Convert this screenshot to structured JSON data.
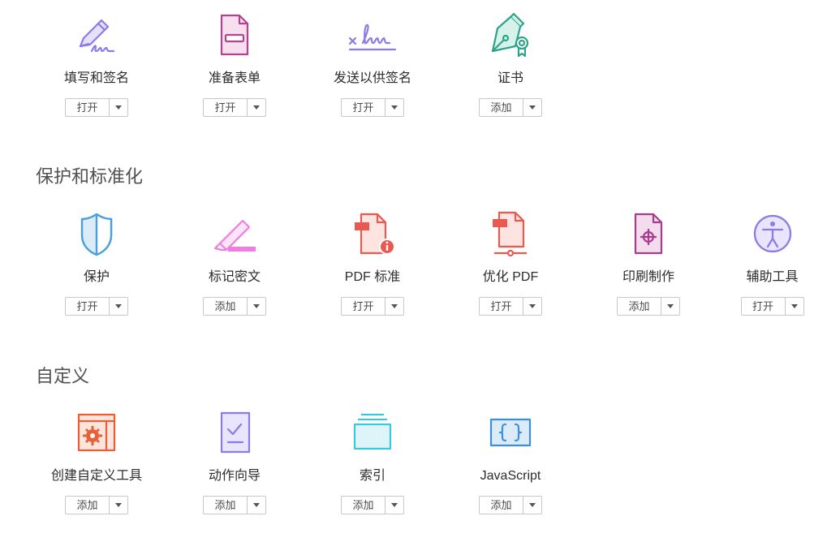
{
  "sections": [
    {
      "title": "",
      "tools": [
        {
          "label": "填写和签名",
          "button": "打开",
          "icon": "fill-sign-icon"
        },
        {
          "label": "准备表单",
          "button": "打开",
          "icon": "prepare-form-icon"
        },
        {
          "label": "发送以供签名",
          "button": "打开",
          "icon": "send-for-signature-icon"
        },
        {
          "label": "证书",
          "button": "添加",
          "icon": "certificate-icon"
        }
      ]
    },
    {
      "title": "保护和标准化",
      "tools": [
        {
          "label": "保护",
          "button": "打开",
          "icon": "shield-icon"
        },
        {
          "label": "标记密文",
          "button": "添加",
          "icon": "redact-icon"
        },
        {
          "label": "PDF 标准",
          "button": "打开",
          "icon": "pdf-standards-icon"
        },
        {
          "label": "优化 PDF",
          "button": "打开",
          "icon": "optimize-pdf-icon"
        },
        {
          "label": "印刷制作",
          "button": "添加",
          "icon": "print-production-icon"
        },
        {
          "label": "辅助工具",
          "button": "打开",
          "icon": "accessibility-icon"
        }
      ]
    },
    {
      "title": "自定义",
      "tools": [
        {
          "label": "创建自定义工具",
          "button": "添加",
          "icon": "create-custom-tool-icon"
        },
        {
          "label": "动作向导",
          "button": "添加",
          "icon": "action-wizard-icon"
        },
        {
          "label": "索引",
          "button": "添加",
          "icon": "index-icon"
        },
        {
          "label": "JavaScript",
          "button": "添加",
          "icon": "javascript-icon"
        }
      ]
    }
  ],
  "colors": {
    "fill_sign": "#8b7be8",
    "prepare_form": "#b0458f",
    "certificate": "#2ea38a",
    "protect": "#4a9fdc",
    "redact": "#ee7ee0",
    "pdf_red": "#e8594f",
    "print_production": "#a83c8c",
    "accessibility": "#8b7be8",
    "custom_tool": "#e8603a",
    "action_wizard": "#8b7be8",
    "index": "#3fc6d8",
    "javascript": "#3d8fdc"
  }
}
